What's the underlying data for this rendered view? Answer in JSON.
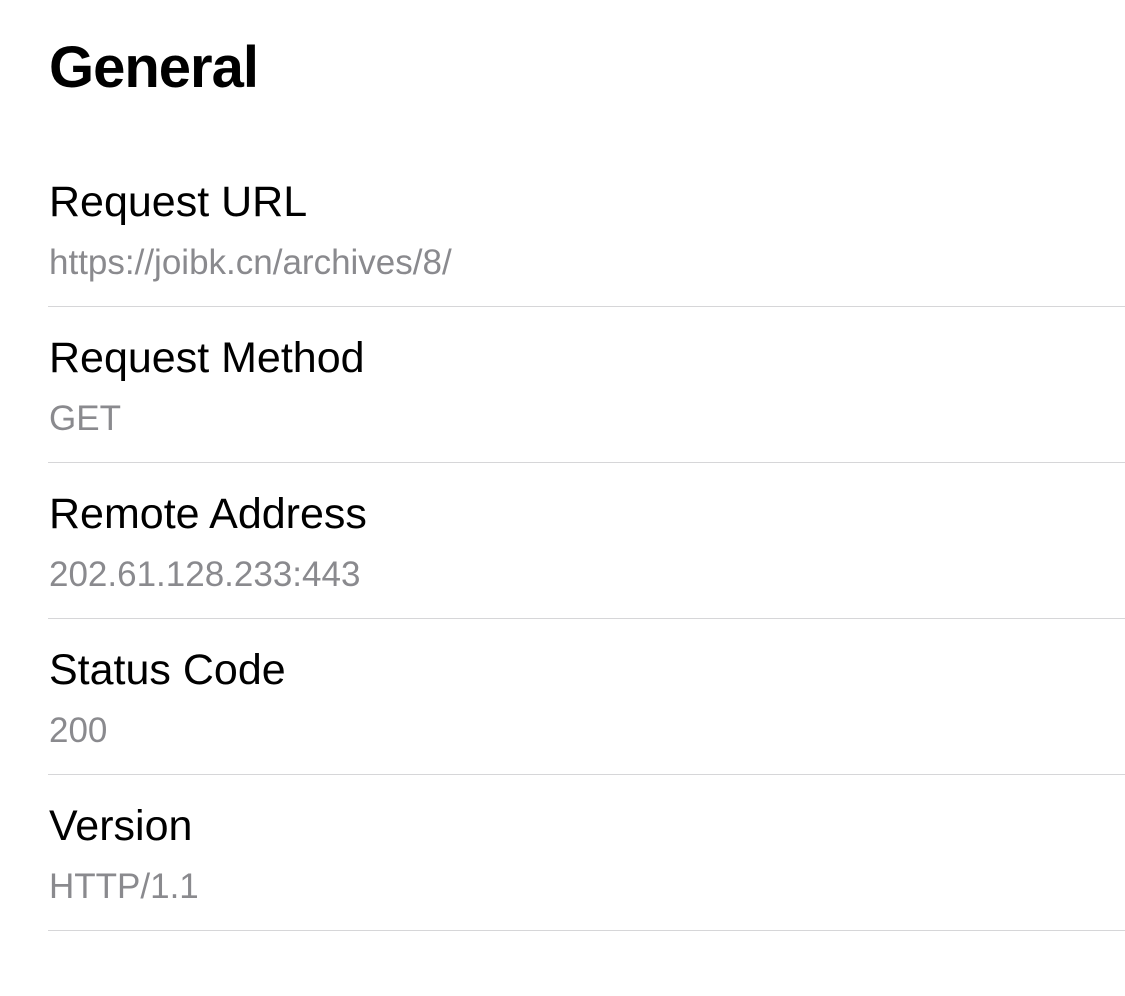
{
  "section": {
    "title": "General"
  },
  "rows": [
    {
      "label": "Request URL",
      "value": "https://joibk.cn/archives/8/"
    },
    {
      "label": "Request Method",
      "value": "GET"
    },
    {
      "label": "Remote Address",
      "value": "202.61.128.233:443"
    },
    {
      "label": "Status Code",
      "value": "200"
    },
    {
      "label": "Version",
      "value": "HTTP/1.1"
    }
  ],
  "colors": {
    "label_text": "#000000",
    "value_text": "#8a8a8e",
    "separator": "#d6d6d8",
    "background": "#ffffff"
  }
}
